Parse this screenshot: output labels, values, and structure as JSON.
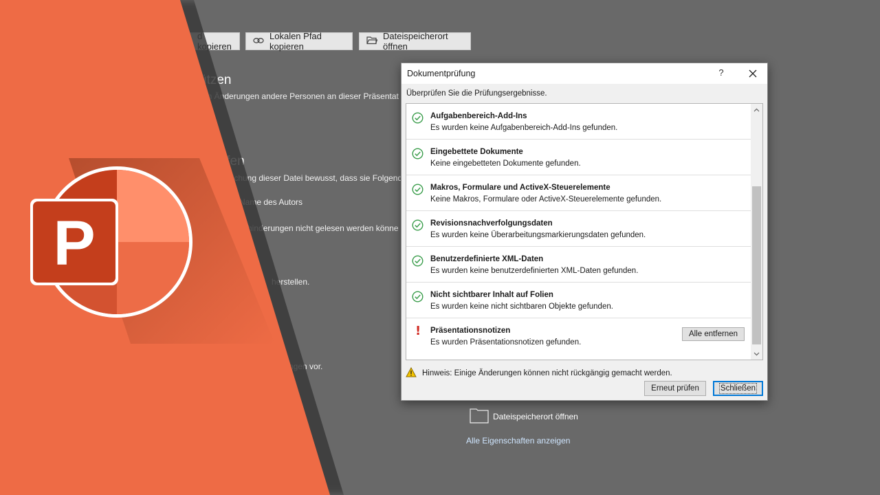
{
  "backstage": {
    "top_buttons": [
      {
        "label": "d kopieren",
        "icon": "none"
      },
      {
        "label": "Lokalen Pfad kopieren",
        "icon": "link-icon"
      },
      {
        "label": "Dateispeicherort öffnen",
        "icon": "folder-open-icon"
      }
    ],
    "section1_heading": "ützen",
    "section1_text": "on Änderungen andere Personen an dieser Präsentat",
    "section2_heading": "ifen",
    "section2_text": "lichung dieser Datei bewusst, dass sie Folgend",
    "bullet_author": "Name des Autors",
    "bullet_impair": "hinderungen nicht gelesen werden könne",
    "restore_text": "herstellen.",
    "changes_text": "ngen vor.",
    "folder_label": "Dateispeicherort öffnen",
    "properties_link": "Alle Eigenschaften anzeigen"
  },
  "logo": {
    "letter": "P"
  },
  "dialog": {
    "title": "Dokumentprüfung",
    "help": "?",
    "subtitle": "Überprüfen Sie die Prüfungsergebnisse.",
    "items": [
      {
        "title": "Aufgabenbereich-Add-Ins",
        "desc": "Es wurden keine Aufgabenbereich-Add-Ins gefunden.",
        "status": "ok"
      },
      {
        "title": "Eingebettete Dokumente",
        "desc": "Keine eingebetteten Dokumente gefunden.",
        "status": "ok"
      },
      {
        "title": "Makros, Formulare und ActiveX-Steuerelemente",
        "desc": "Keine Makros, Formulare oder ActiveX-Steuerelemente gefunden.",
        "status": "ok"
      },
      {
        "title": "Revisionsnachverfolgungsdaten",
        "desc": "Es wurden keine Überarbeitungsmarkierungsdaten gefunden.",
        "status": "ok"
      },
      {
        "title": "Benutzerdefinierte XML-Daten",
        "desc": "Es wurden keine benutzerdefinierten XML-Daten gefunden.",
        "status": "ok"
      },
      {
        "title": "Nicht sichtbarer Inhalt auf Folien",
        "desc": "Es wurden keine nicht sichtbaren Objekte gefunden.",
        "status": "ok"
      },
      {
        "title": "Präsentationsnotizen",
        "desc": "Es wurden Präsentationsnotizen gefunden.",
        "status": "warning",
        "action": "Alle entfernen"
      }
    ],
    "notice_mark": "!",
    "notice": "Hinweis: Einige Änderungen können nicht rückgängig gemacht werden.",
    "recheck_label": "Erneut prüfen",
    "close_label": "Schließen"
  },
  "colors": {
    "accent": "#0078d7",
    "ok": "#3a9d4b",
    "warning": "#d22f27",
    "orange": "#ee6b45"
  }
}
